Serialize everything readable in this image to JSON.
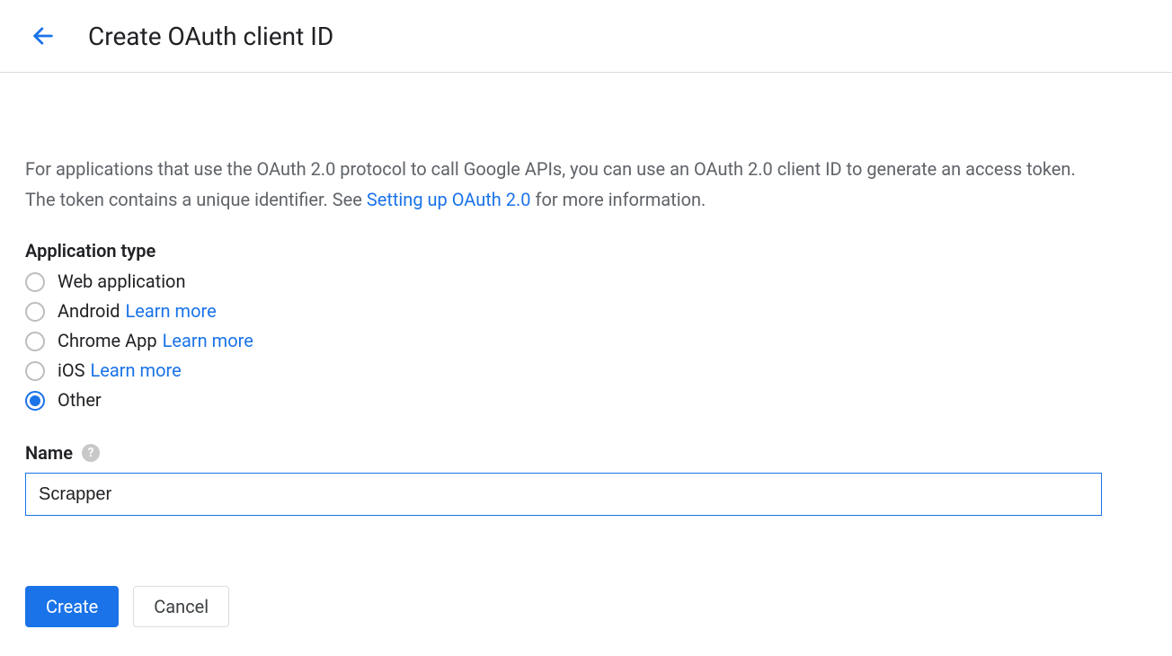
{
  "header": {
    "title": "Create OAuth client ID"
  },
  "intro": {
    "lead": "For applications that use the OAuth 2.0 protocol to call Google APIs, you can use an OAuth 2.0 client ID to generate an access token. The token contains a unique identifier. See ",
    "link_text": "Setting up OAuth 2.0",
    "trail": " for more information."
  },
  "app_type": {
    "label": "Application type",
    "learn_more": "Learn more",
    "options": [
      {
        "label": "Web application",
        "has_learn_more": false,
        "selected": false
      },
      {
        "label": "Android",
        "has_learn_more": true,
        "selected": false
      },
      {
        "label": "Chrome App",
        "has_learn_more": true,
        "selected": false
      },
      {
        "label": "iOS",
        "has_learn_more": true,
        "selected": false
      },
      {
        "label": "Other",
        "has_learn_more": false,
        "selected": true
      }
    ]
  },
  "name": {
    "label": "Name",
    "value": "Scrapper"
  },
  "buttons": {
    "create": "Create",
    "cancel": "Cancel"
  }
}
